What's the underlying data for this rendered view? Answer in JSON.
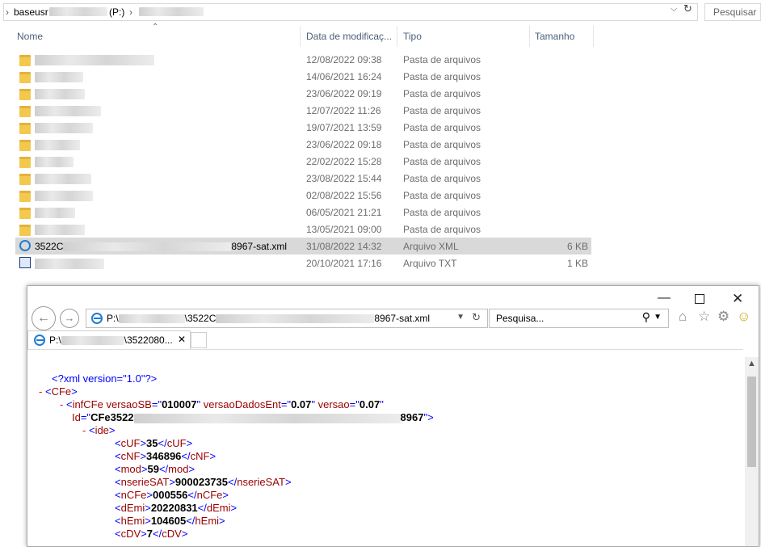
{
  "explorer": {
    "breadcrumb": {
      "root": "baseusr",
      "drive": "(P:)"
    },
    "search_label": "Pesquisar",
    "columns": {
      "name": "Nome",
      "date": "Data de modificaç...",
      "type": "Tipo",
      "size": "Tamanho"
    },
    "files": [
      {
        "name": "",
        "date": "12/08/2022 09:38",
        "type": "Pasta de arquivos",
        "size": "",
        "kind": "folder"
      },
      {
        "name": "",
        "date": "14/06/2021 16:24",
        "type": "Pasta de arquivos",
        "size": "",
        "kind": "folder"
      },
      {
        "name": "",
        "date": "23/06/2022 09:19",
        "type": "Pasta de arquivos",
        "size": "",
        "kind": "folder"
      },
      {
        "name": "",
        "date": "12/07/2022 11:26",
        "type": "Pasta de arquivos",
        "size": "",
        "kind": "folder"
      },
      {
        "name": "",
        "date": "19/07/2021 13:59",
        "type": "Pasta de arquivos",
        "size": "",
        "kind": "folder"
      },
      {
        "name": "",
        "date": "23/06/2022 09:18",
        "type": "Pasta de arquivos",
        "size": "",
        "kind": "folder"
      },
      {
        "name": "",
        "date": "22/02/2022 15:28",
        "type": "Pasta de arquivos",
        "size": "",
        "kind": "folder"
      },
      {
        "name": "",
        "date": "23/08/2022 15:44",
        "type": "Pasta de arquivos",
        "size": "",
        "kind": "folder"
      },
      {
        "name": "",
        "date": "02/08/2022 15:56",
        "type": "Pasta de arquivos",
        "size": "",
        "kind": "folder"
      },
      {
        "name": "",
        "date": "06/05/2021 21:21",
        "type": "Pasta de arquivos",
        "size": "",
        "kind": "folder"
      },
      {
        "name": "",
        "date": "13/05/2021 09:00",
        "type": "Pasta de arquivos",
        "size": "",
        "kind": "folder"
      },
      {
        "name": "3522C",
        "name_end": "8967-sat.xml",
        "date": "31/08/2022 14:32",
        "type": "Arquivo XML",
        "size": "6 KB",
        "kind": "xml",
        "selected": true
      },
      {
        "name": "",
        "date": "20/10/2021 17:16",
        "type": "Arquivo TXT",
        "size": "1 KB",
        "kind": "txt"
      }
    ]
  },
  "browser": {
    "url_start": "P:\\",
    "url_mid": "\\3522C",
    "url_end": "8967-sat.xml",
    "search_placeholder": "Pesquisa...",
    "tab_title_start": "P:\\",
    "tab_title_end": "\\3522080...",
    "xml": {
      "decl": "<?xml version=\"1.0\"?>",
      "root_tag": "CFe",
      "infcfe": {
        "tag": "infCFe",
        "attr1": "versaoSB",
        "val1": "010007",
        "attr2": "versaoDadosEnt",
        "val2": "0.07",
        "attr3": "versao",
        "val3": "0.07",
        "id_attr": "Id",
        "id_start": "CFe3522",
        "id_end": "8967"
      },
      "ide_tag": "ide",
      "fields": [
        {
          "tag": "cUF",
          "value": "35"
        },
        {
          "tag": "cNF",
          "value": "346896"
        },
        {
          "tag": "mod",
          "value": "59"
        },
        {
          "tag": "nserieSAT",
          "value": "900023735"
        },
        {
          "tag": "nCFe",
          "value": "000556"
        },
        {
          "tag": "dEmi",
          "value": "20220831"
        },
        {
          "tag": "hEmi",
          "value": "104605"
        },
        {
          "tag": "cDV",
          "value": "7"
        }
      ]
    }
  }
}
